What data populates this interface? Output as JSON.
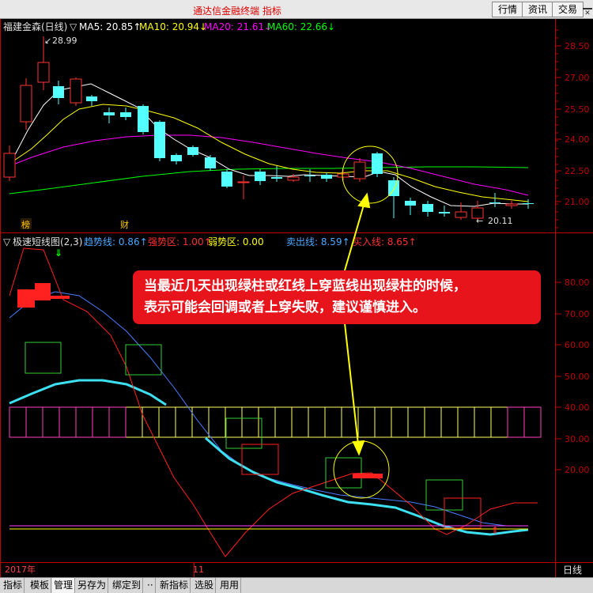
{
  "window": {
    "title": "通达信金融终端  指标",
    "buttons": [
      "行情",
      "资讯",
      "交易"
    ],
    "window_controls": [
      "minimize-icon",
      "close-icon"
    ]
  },
  "price_panel": {
    "stock_name": "福建金森(日线)",
    "ma_labels": [
      {
        "label": "MA5: 20.85",
        "arrow": "↑",
        "color": "#ffffff"
      },
      {
        "label": "MA10: 20.94",
        "arrow": "↓",
        "color": "#ffff00"
      },
      {
        "label": "MA20: 21.61",
        "arrow": "↓",
        "color": "#ff00ff"
      },
      {
        "label": "MA60: 22.66",
        "arrow": "↓",
        "color": "#00ff00"
      }
    ],
    "high_label": "28.99",
    "low_label": "20.11",
    "markers": [
      "榜",
      "财"
    ],
    "y_ticks": [
      "28.50",
      "27.00",
      "25.50",
      "24.00",
      "22.50",
      "21.00"
    ]
  },
  "indicator_panel": {
    "name": "极速短线图(2,3)",
    "labels": [
      {
        "label": "趋势线: 0.86",
        "arrow": "↑",
        "color": "#4aa8ff"
      },
      {
        "label": "强势区: 1.00",
        "arrow": "↑",
        "color": "#ff3030"
      },
      {
        "label": "弱势区: 0.00",
        "arrow": "",
        "color": "#ffff00"
      },
      {
        "label": "卖出线: 8.59",
        "arrow": "↑",
        "color": "#4aa8ff"
      },
      {
        "label": "买入线: 8.65",
        "arrow": "↑",
        "color": "#ff3030"
      }
    ],
    "y_ticks": [
      "80.00",
      "70.00",
      "60.00",
      "50.00",
      "40.00",
      "30.00",
      "20.00"
    ]
  },
  "annotation": {
    "lines": [
      "当最近几天出现绿柱或红线上穿蓝线出现绿柱的时候，",
      "表示可能会回调或者上穿失败，建议谨慎进入。"
    ]
  },
  "axis": {
    "year_label": "2017年",
    "month_label": "11",
    "period_label": "日线"
  },
  "statusbar": {
    "items": [
      "指标",
      "模板",
      "管理",
      "另存为",
      "绑定到",
      "··",
      "新指标",
      "选股",
      "用用"
    ],
    "active_item": "管理"
  },
  "colors": {
    "up": "#ff3232",
    "down": "#54ffff",
    "ma5": "#ffffff",
    "ma10": "#ffff00",
    "ma20": "#ff00ff",
    "ma60": "#00ff00",
    "trend": "#4aa8ff",
    "strong": "#ff3030",
    "weak": "#ffff00",
    "annotation": "#e8141c"
  }
}
